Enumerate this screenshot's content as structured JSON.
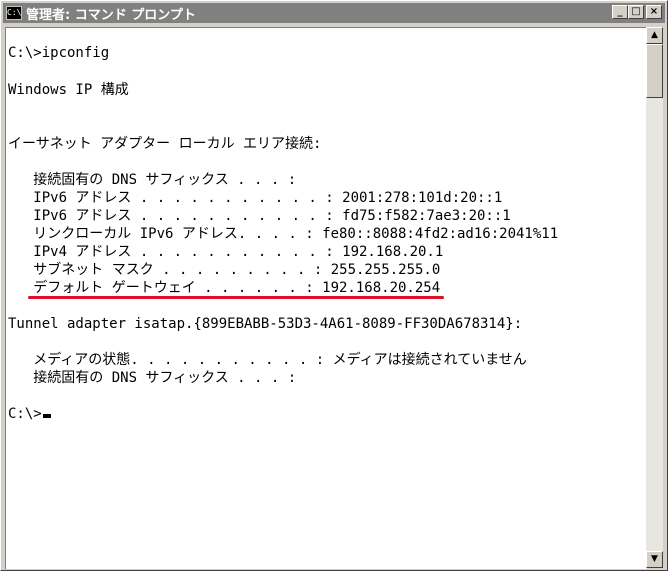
{
  "window": {
    "title": "管理者: コマンド プロンプト",
    "icon_label": "C:\\",
    "buttons": {
      "minimize": "_",
      "maximize": "□",
      "close": "×"
    }
  },
  "console": {
    "lines": [
      "C:\\>ipconfig",
      "Windows IP 構成",
      "イーサネット アダプター ローカル エリア接続:",
      "   接続固有の DNS サフィックス . . . :",
      "   IPv6 アドレス . . . . . . . . . . . : 2001:278:101d:20::1",
      "   IPv6 アドレス . . . . . . . . . . . : fd75:f582:7ae3:20::1",
      "   リンクローカル IPv6 アドレス. . . . : fe80::8088:4fd2:ad16:2041%11",
      "   IPv4 アドレス . . . . . . . . . . . : 192.168.20.1",
      "   サブネット マスク . . . . . . . . . : 255.255.255.0",
      "   デフォルト ゲートウェイ . . . . . . : 192.168.20.254",
      "Tunnel adapter isatap.{899EBABB-53D3-4A61-8089-FF30DA678314}:",
      "   メディアの状態. . . . . . . . . . . : メディアは接続されていません",
      "   接続固有の DNS サフィックス . . . :",
      "C:\\>"
    ]
  },
  "scrollbar": {
    "up_arrow": "▲",
    "down_arrow": "▼"
  },
  "colors": {
    "highlight_underline": "#e0102a",
    "titlebar": "#808080"
  }
}
